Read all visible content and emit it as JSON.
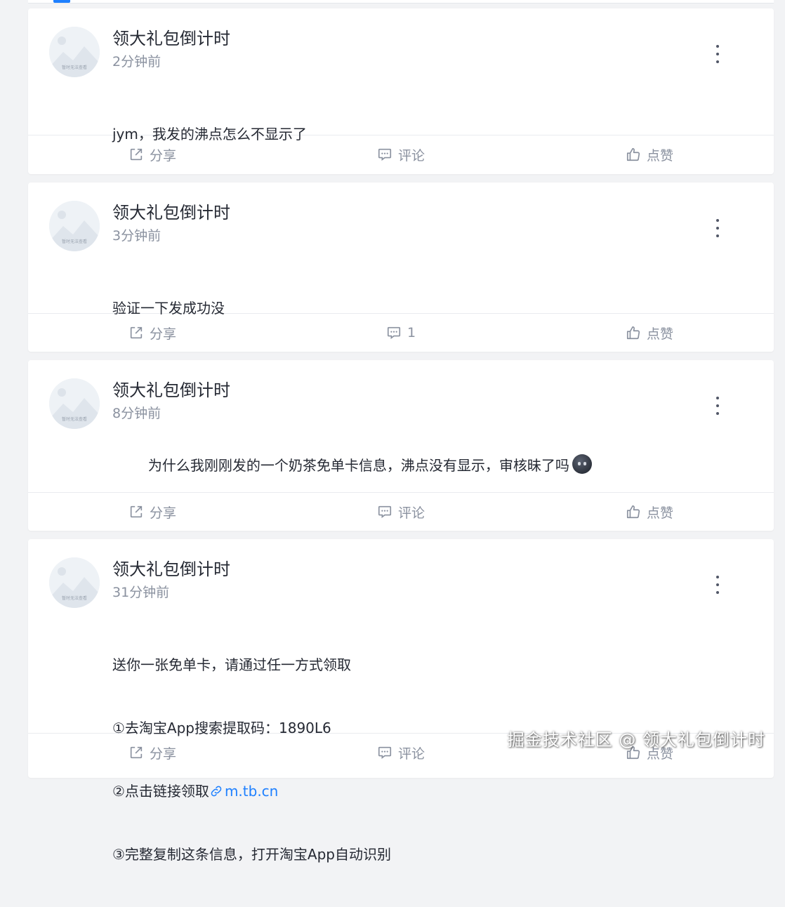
{
  "posts": [
    {
      "author": "领大礼包倒计时",
      "time": "2分钟前",
      "content_lines": [
        "jym，我发的沸点怎么不显示了"
      ],
      "share_label": "分享",
      "comment_label": "评论",
      "like_label": "点赞"
    },
    {
      "author": "领大礼包倒计时",
      "time": "3分钟前",
      "content_lines": [
        "验证一下发成功没"
      ],
      "share_label": "分享",
      "comment_label": "1",
      "like_label": "点赞"
    },
    {
      "author": "领大礼包倒计时",
      "time": "8分钟前",
      "content_lines": [
        "为什么我刚刚发的一个奶茶免单卡信息，沸点没有显示，审核昧了吗"
      ],
      "share_label": "分享",
      "comment_label": "评论",
      "like_label": "点赞"
    },
    {
      "author": "领大礼包倒计时",
      "time": "31分钟前",
      "content_lines": [
        "送你一张免单卡，请通过任一方式领取",
        "①去淘宝App搜索提取码：1890L6",
        "②点击链接领取",
        "③完整复制这条信息，打开淘宝App自动识别"
      ],
      "link_text": "m.tb.cn",
      "share_label": "分享",
      "comment_label": "评论",
      "like_label": "点赞"
    }
  ],
  "avatar_icon": "image-unavailable-placeholder-icon",
  "avatar_text": "暂时无法查看",
  "watermark": "掘金技术社区 @ 领大礼包倒计时",
  "colors": {
    "accent": "#1e80ff",
    "text": "#252933",
    "muted": "#8a919f",
    "background": "#f2f3f5"
  }
}
